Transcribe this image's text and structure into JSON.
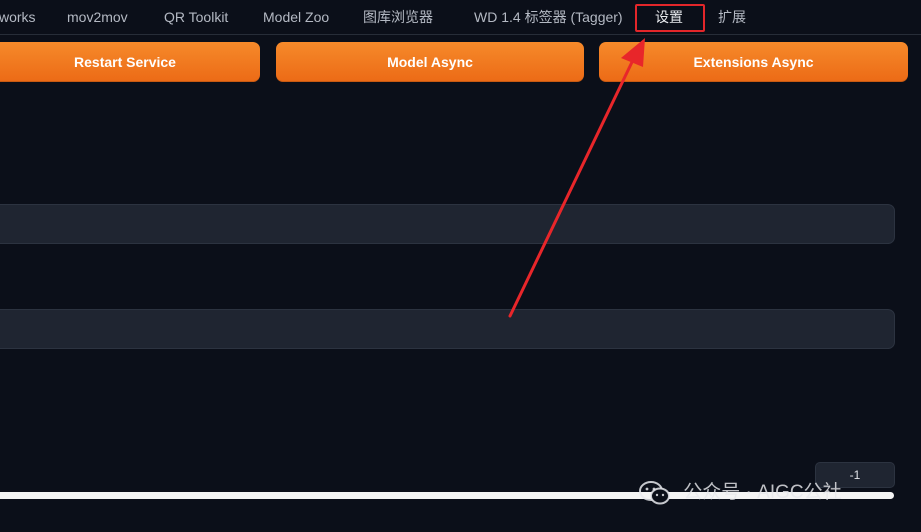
{
  "tabs": [
    {
      "label": "works"
    },
    {
      "label": "mov2mov"
    },
    {
      "label": "QR Toolkit"
    },
    {
      "label": "Model Zoo"
    },
    {
      "label": "图库浏览器"
    },
    {
      "label": "WD 1.4 标签器 (Tagger)"
    },
    {
      "label": "设置"
    },
    {
      "label": "扩展"
    }
  ],
  "actions": {
    "restart_label": "Restart Service",
    "model_async_label": "Model Async",
    "extensions_async_label": "Extensions Async"
  },
  "number_field": {
    "value": "-1"
  },
  "watermark": {
    "text": "公众号 · AIGC公社"
  },
  "colors": {
    "background": "#0b0f19",
    "accent": "#f07a22",
    "highlight": "#e3262a"
  }
}
